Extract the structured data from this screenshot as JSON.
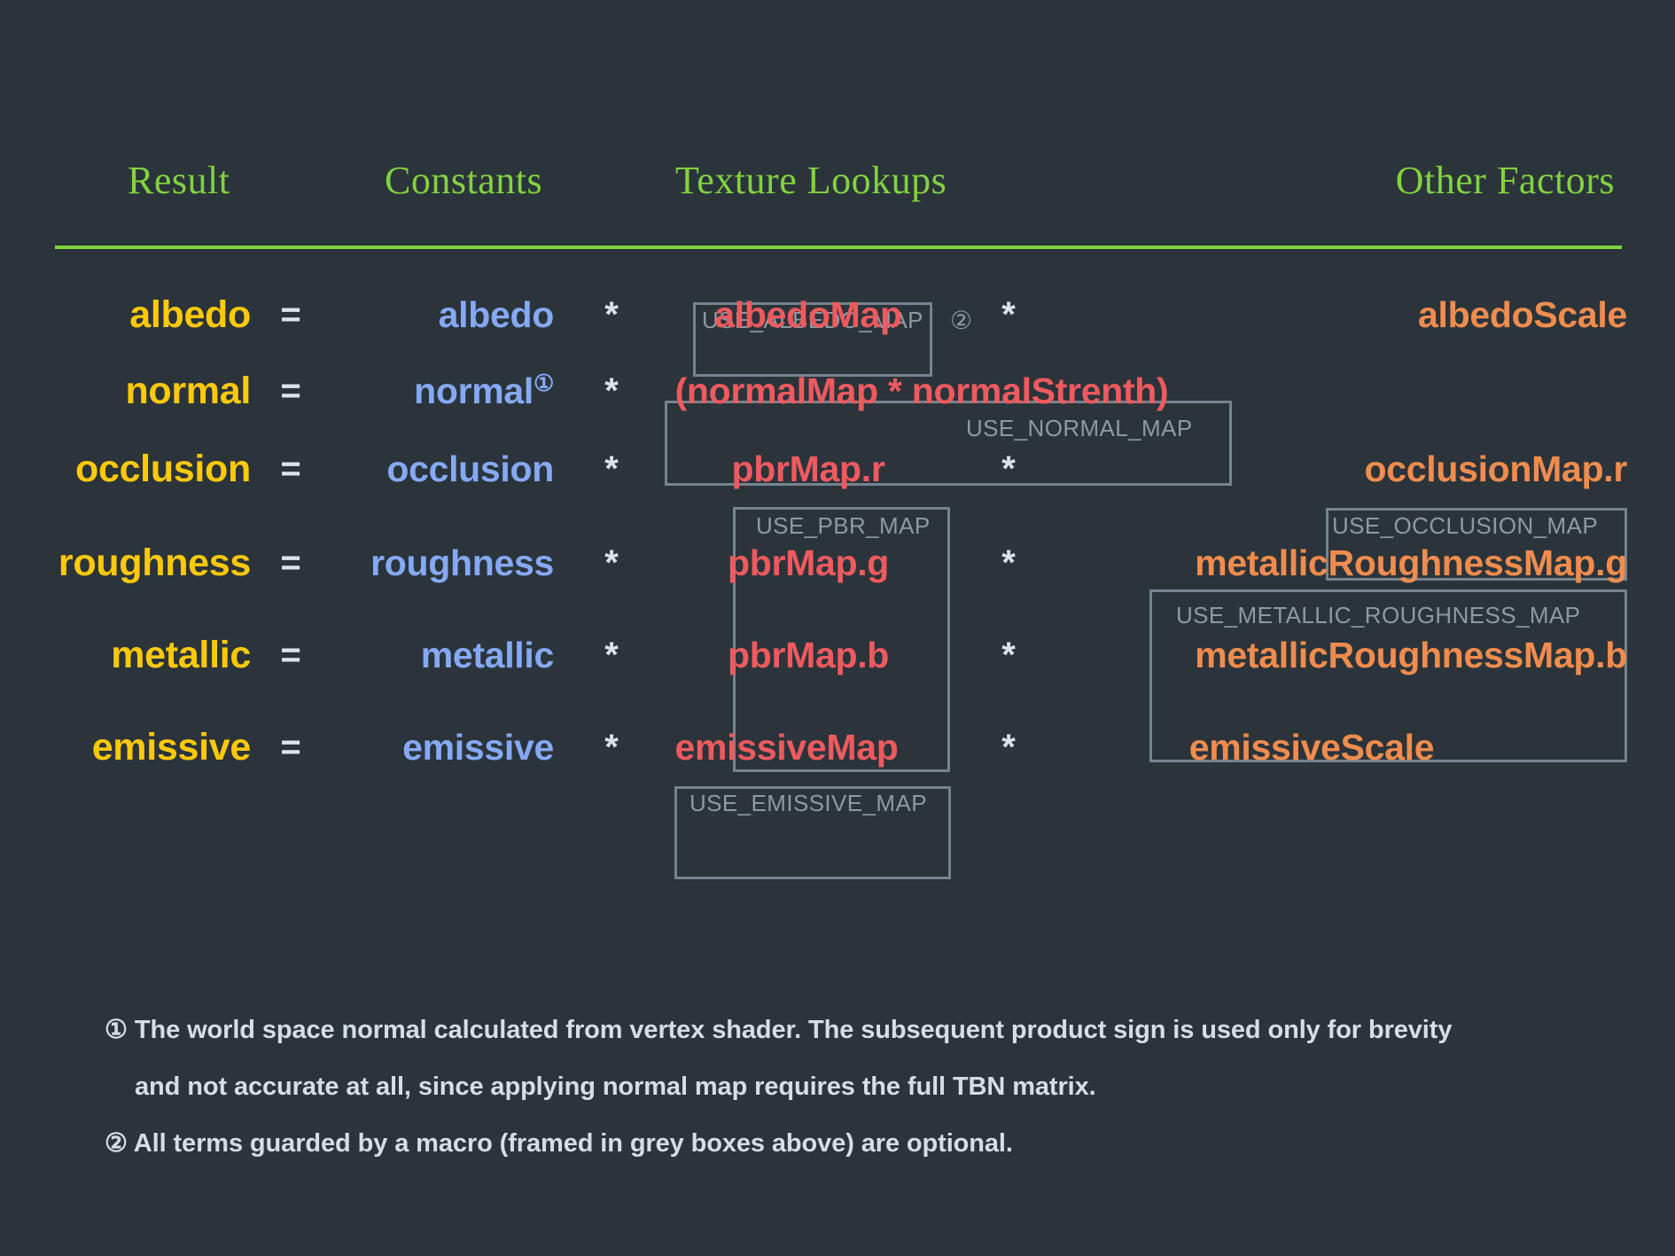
{
  "theme": {
    "background": "#2b343b",
    "header_green": "#82d23e",
    "result_yellow": "#ffc90a",
    "constant_blue": "#85a9f4",
    "texture_red": "#ee5a5e",
    "other_orange": "#f08c4d",
    "macro_grey": "#8d99a3",
    "border_grey": "#77838d",
    "operator_white": "#dde3e9"
  },
  "headers": {
    "result": "Result",
    "constants": "Constants",
    "texture_lookups": "Texture Lookups",
    "other_factors": "Other Factors"
  },
  "operators": {
    "equals": "=",
    "star": "*"
  },
  "rows": [
    {
      "result": "albedo",
      "constant": "albedo",
      "constant_sup": "",
      "texture": "albedoMap",
      "texture_macro": "USE_ALBEDO_MAP",
      "texture_macro_note": "②",
      "other": "albedoScale",
      "other_macro": ""
    },
    {
      "result": "normal",
      "constant": "normal",
      "constant_sup": "①",
      "texture": "(normalMap * normalStrenth)",
      "texture_macro": "USE_NORMAL_MAP",
      "texture_macro_note": "",
      "other": "",
      "other_macro": ""
    },
    {
      "result": "occlusion",
      "constant": "occlusion",
      "constant_sup": "",
      "texture": "pbrMap.r",
      "texture_macro": "USE_PBR_MAP",
      "texture_macro_note": "",
      "other": "occlusionMap.r",
      "other_macro": "USE_OCCLUSION_MAP"
    },
    {
      "result": "roughness",
      "constant": "roughness",
      "constant_sup": "",
      "texture": "pbrMap.g",
      "texture_macro": "",
      "texture_macro_note": "",
      "other": "metallicRoughnessMap.g",
      "other_macro": "USE_METALLIC_ROUGHNESS_MAP"
    },
    {
      "result": "metallic",
      "constant": "metallic",
      "constant_sup": "",
      "texture": "pbrMap.b",
      "texture_macro": "",
      "texture_macro_note": "",
      "other": "metallicRoughnessMap.b",
      "other_macro": ""
    },
    {
      "result": "emissive",
      "constant": "emissive",
      "constant_sup": "",
      "texture": "emissiveMap",
      "texture_macro": "USE_EMISSIVE_MAP",
      "texture_macro_note": "",
      "other": "emissiveScale",
      "other_macro": ""
    }
  ],
  "footnotes": {
    "note1_line1": "① The world space normal calculated from vertex shader. The subsequent product sign is used only for brevity",
    "note1_line2": "and not accurate at all, since applying normal map requires the full TBN matrix.",
    "note2": "② All terms guarded by a macro (framed in grey boxes above) are optional."
  }
}
